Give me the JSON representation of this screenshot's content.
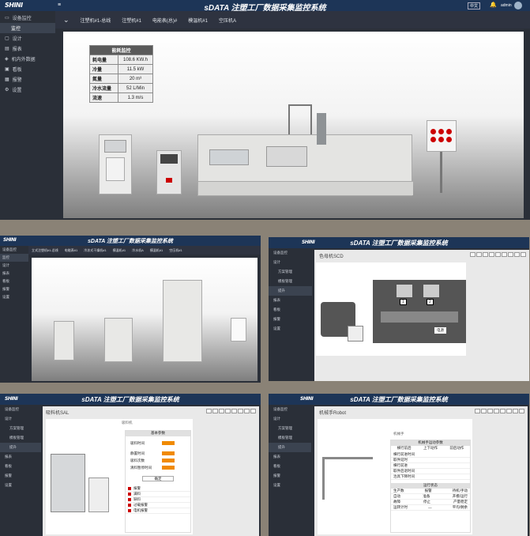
{
  "main": {
    "logo": "SHINI",
    "title": "sDATA 注塑工厂数据采集监控系统",
    "lang": "中文",
    "user": "admin",
    "sidebar": [
      {
        "label": "设备监控",
        "icon": "monitor-icon",
        "active": false
      },
      {
        "label": "监控",
        "icon": "",
        "active": true
      },
      {
        "label": "设计",
        "icon": "design-icon"
      },
      {
        "label": "报表",
        "icon": "report-icon"
      },
      {
        "label": "机内外数据",
        "icon": "data-icon"
      },
      {
        "label": "看板",
        "icon": "board-icon"
      },
      {
        "label": "报警",
        "icon": "alarm-icon"
      },
      {
        "label": "设置",
        "icon": "settings-icon"
      }
    ],
    "tabs": [
      "注塑机#1-总线",
      "注塑机#1",
      "电能表(总)#",
      "模温机#1",
      "空压机A"
    ],
    "energy": {
      "title": "能耗监控",
      "rows": [
        {
          "k": "耗电量",
          "v": "108.6 KW.h"
        },
        {
          "k": "冷量",
          "v": "11.5 kW"
        },
        {
          "k": "氮量",
          "v": "20 m³"
        },
        {
          "k": "冷水流量",
          "v": "52 L/Min"
        },
        {
          "k": "流速",
          "v": "1.3 m/s"
        }
      ]
    }
  },
  "p2": {
    "logo": "SHINI",
    "title": "sDATA 注塑工厂数据采集监控系统",
    "sidebar": [
      "设备监控",
      "监控",
      "设计",
      "报表",
      "看板",
      "报警",
      "设置"
    ],
    "tabs": [
      "立式注塑机#1-总线",
      "电能表#1",
      "冷冻式干燥机#1",
      "模温机#1",
      "冷水机A",
      "模温机#1",
      "空压机#1"
    ]
  },
  "p3": {
    "logo": "SHINI",
    "title": "sDATA 注塑工厂数据采集监控系统",
    "sidebar": [
      "设备监控",
      "设计",
      "方案管理",
      "模板管理",
      "提升",
      "报表",
      "看板",
      "报警",
      "设置"
    ],
    "page_title": "色母机SCD",
    "left_box": "1",
    "right_box": "2",
    "center_button": "电源"
  },
  "p4": {
    "logo": "SHINI",
    "title": "sDATA 注塑工厂数据采集监控系统",
    "sidebar": [
      "设备监控",
      "设计",
      "方案管理",
      "模板管理",
      "提升",
      "报表",
      "看板",
      "报警",
      "设置"
    ],
    "page_title": "吸料机SAL",
    "panel_title": "吸料机",
    "group": "基本参数",
    "fields": [
      "吸料时间",
      "静置时间",
      "吸料次数",
      "清料暂停时间"
    ],
    "button": "确定",
    "list": [
      "报警",
      "满料",
      "缺料",
      "过载报警",
      "电机报警"
    ]
  },
  "p5": {
    "logo": "SHINI",
    "title": "sDATA 注塑工厂数据采集监控系统",
    "sidebar": [
      "设备监控",
      "设计",
      "方案管理",
      "模板管理",
      "提升",
      "报表",
      "看板",
      "报警",
      "设置"
    ],
    "page_title": "机械手Robot",
    "panel_title": "机械手",
    "table_title": "机械手运动参数",
    "cols": [
      "横行前后",
      "上下动作",
      "前后动作"
    ],
    "rows": [
      "横行前进时间",
      "取件延时",
      "横行前进",
      "取件后退时间",
      "治具下降时间"
    ],
    "status_title": "运行状态",
    "status": [
      [
        "生产数",
        "报警",
        "待机/手动"
      ],
      [
        "自动",
        "准备",
        "开模/运行"
      ],
      [
        "故障",
        "停止",
        "产量稳定"
      ],
      [
        "运转计时",
        "—",
        "平均/剩余"
      ]
    ]
  }
}
